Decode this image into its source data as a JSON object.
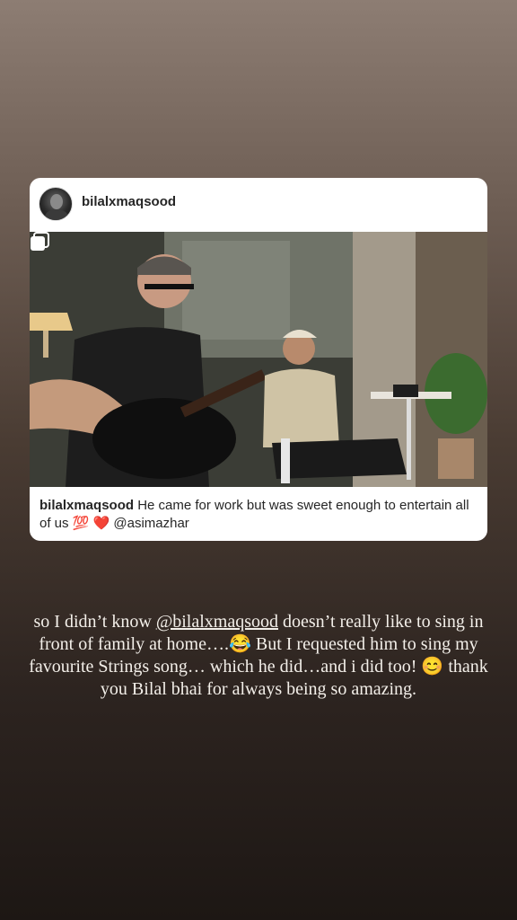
{
  "post": {
    "username": "bilalxmaqsood",
    "caption_user": "bilalxmaqsood",
    "caption_text": " He came for work but was sweet enough to entertain all of us ",
    "caption_emojis": "💯 ❤️",
    "caption_mention": " @asimazhar",
    "icons": {
      "avatar": "profile-avatar",
      "multi": "carousel-multiple-icon"
    }
  },
  "story": {
    "line1_pre": "so I didn’t know ",
    "mention": "@bilalxmaqsood",
    "line1_post": " doesn’t really like to sing in front of family at home….",
    "emoji1": "😂",
    "part2": " But I requested him to sing my favourite Strings song… which he did…and i did too! ",
    "emoji2": "😊",
    "part3": " thank you Bilal bhai for always being so amazing."
  }
}
